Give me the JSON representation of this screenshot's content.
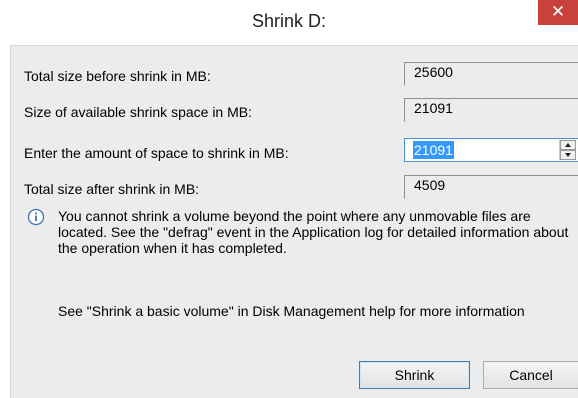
{
  "window": {
    "title": "Shrink D:",
    "close_glyph": "✕"
  },
  "fields": {
    "total_before_label": "Total size before shrink in MB:",
    "total_before_value": "25600",
    "available_label": "Size of available shrink space in MB:",
    "available_value": "21091",
    "amount_label": "Enter the amount of space to shrink in MB:",
    "amount_value": "21091",
    "total_after_label": "Total size after shrink in MB:",
    "total_after_value": "4509"
  },
  "info": {
    "icon": "info-icon",
    "text": "You cannot shrink a volume beyond the point where any unmovable files are located. See the \"defrag\" event in the Application log for detailed information about the operation when it has completed."
  },
  "help": {
    "text": "See \"Shrink a basic volume\" in Disk Management help for more information"
  },
  "buttons": {
    "shrink_label": "Shrink",
    "cancel_label": "Cancel"
  },
  "colors": {
    "close_button": "#c8413c",
    "selection": "#3399ff",
    "focus_border": "#4f8fd6"
  }
}
